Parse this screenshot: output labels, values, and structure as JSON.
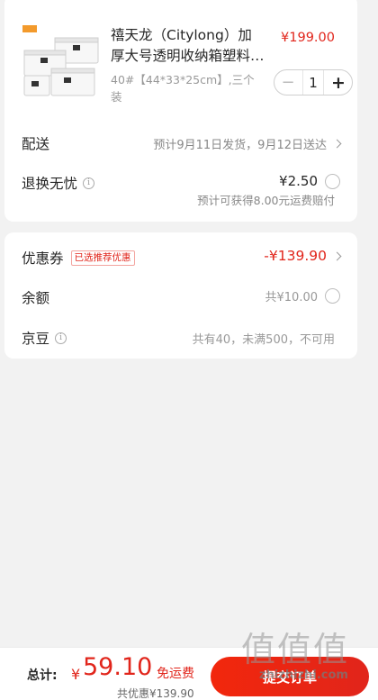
{
  "product": {
    "title": "禧天龙（Citylong）加厚大号透明收纳箱塑料储物箱",
    "price": "¥199.00",
    "spec": "40#【44*33*25cm】,三个装",
    "quantity": "1",
    "minus_symbol": "−",
    "plus_symbol": "+"
  },
  "delivery": {
    "label": "配送",
    "value": "预计9月11日发货，9月12日送达"
  },
  "return_insurance": {
    "label": "退换无忧",
    "price": "¥2.50",
    "note": "预计可获得8.00元运费赔付"
  },
  "coupon": {
    "label": "优惠券",
    "badge": "已选推荐优惠",
    "value": "-¥139.90"
  },
  "balance": {
    "label": "余额",
    "value": "共¥10.00"
  },
  "jingdou": {
    "label": "京豆",
    "value": "共有40，未满500，不可用"
  },
  "footer": {
    "total_label": "总计:",
    "currency": "¥",
    "total_amount": "59.10",
    "free_shipping": "免运费",
    "saved": "共优惠¥139.90",
    "submit_label": "提交订单"
  },
  "watermark": {
    "logo": "值值值",
    "text": "zhizhizhi.com"
  },
  "colors": {
    "accent": "#e1251b",
    "background": "#f2f2f2",
    "card": "#ffffff"
  }
}
